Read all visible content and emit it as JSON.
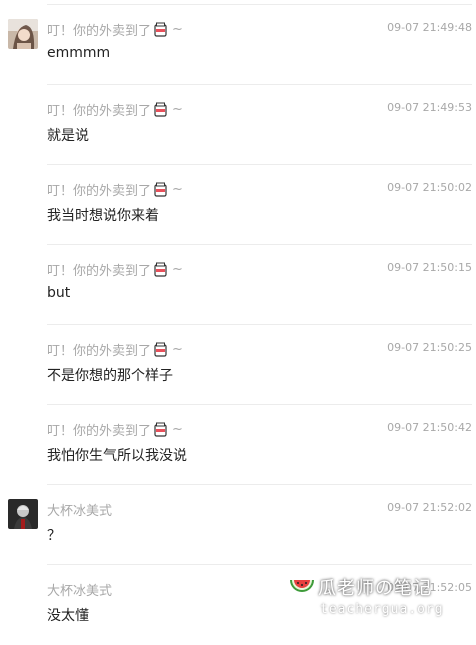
{
  "messages": [
    {
      "sender": "叮！你的外卖到了",
      "tilde": "~",
      "time": "09-07 21:49:48",
      "text": "emmmm",
      "avatar": "girl"
    },
    {
      "sender": "叮！你的外卖到了",
      "tilde": "~",
      "time": "09-07 21:49:53",
      "text": "就是说"
    },
    {
      "sender": "叮！你的外卖到了",
      "tilde": "~",
      "time": "09-07 21:50:02",
      "text": "我当时想说你来着"
    },
    {
      "sender": "叮！你的外卖到了",
      "tilde": "~",
      "time": "09-07 21:50:15",
      "text": "but"
    },
    {
      "sender": "叮！你的外卖到了",
      "tilde": "~",
      "time": "09-07 21:50:25",
      "text": "不是你想的那个样子"
    },
    {
      "sender": "叮！你的外卖到了",
      "tilde": "~",
      "time": "09-07 21:50:42",
      "text": "我怕你生气所以我没说"
    },
    {
      "sender": "大杯冰美式",
      "time": "09-07 21:52:02",
      "text": "？",
      "avatar": "boy"
    },
    {
      "sender": "大杯冰美式",
      "time": "09-07 21:52:05",
      "text": "没太懂"
    }
  ],
  "watermark": {
    "main": "瓜老师の笔记",
    "sub": "teachergua.org"
  },
  "colors": {
    "meta": "#a8a8a8",
    "text": "#222222",
    "divider": "#ececec"
  }
}
